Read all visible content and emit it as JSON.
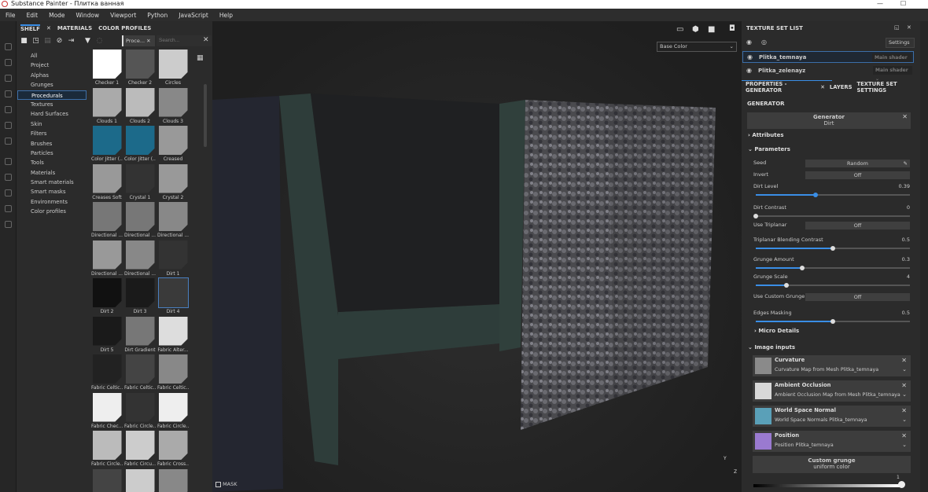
{
  "window": {
    "title": "Substance Painter - Плитка ванная"
  },
  "menu": [
    "File",
    "Edit",
    "Mode",
    "Window",
    "Viewport",
    "Python",
    "JavaScript",
    "Help"
  ],
  "shelf": {
    "tabs": [
      "SHELF",
      "MATERIALS",
      "COLOR PROFILES"
    ],
    "filter_chip": "Proce...",
    "search_placeholder": "Search...",
    "categories": [
      "All",
      "Project",
      "Alphas",
      "Grunges",
      "Procedurals",
      "Textures",
      "Hard Surfaces",
      "Skin",
      "Filters",
      "Brushes",
      "Particles",
      "Tools",
      "Materials",
      "Smart materials",
      "Smart masks",
      "Environments",
      "Color profiles"
    ],
    "selected_category": "Procedurals",
    "items": [
      "Checker 1",
      "Checker 2",
      "Circles",
      "Clouds 1",
      "Clouds 2",
      "Clouds 3",
      "Color Jitter (...",
      "Color Jitter (...",
      "Creased",
      "Creases Soft",
      "Crystal 1",
      "Crystal 2",
      "Directional ...",
      "Directional ...",
      "Directional ...",
      "Directional ...",
      "Directional ...",
      "Dirt 1",
      "Dirt 2",
      "Dirt 3",
      "Dirt 4",
      "Dirt 5",
      "Dirt Gradient",
      "Fabric Alter...",
      "Fabric Celtic...",
      "Fabric Celtic...",
      "Fabric Celtic...",
      "Fabric Chec...",
      "Fabric Circle...",
      "Fabric Circle...",
      "Fabric Circle...",
      "Fabric Circu...",
      "Fabric Cross...",
      "",
      "",
      ""
    ],
    "selected_item": "Dirt 4"
  },
  "viewport": {
    "channel": "Base Color",
    "mask_label": "MASK",
    "axis_y": "Y",
    "axis_z": "Z"
  },
  "texture_set_list": {
    "title": "TEXTURE SET LIST",
    "settings": "Settings",
    "sets": [
      {
        "name": "Plitka_temnaya",
        "shader": "Main shader"
      },
      {
        "name": "Plitka_zelenayz",
        "shader": "Main shader"
      }
    ]
  },
  "properties": {
    "tabs": [
      "PROPERTIES - GENERATOR",
      "LAYERS",
      "TEXTURE SET SETTINGS"
    ],
    "section": "GENERATOR",
    "generator_label": "Generator",
    "generator_value": "Dirt",
    "attributes": "Attributes",
    "parameters": "Parameters",
    "params": [
      {
        "label": "Seed",
        "type": "button",
        "value": "Random"
      },
      {
        "label": "Invert",
        "type": "button",
        "value": "Off"
      },
      {
        "label": "Dirt Level",
        "type": "slider",
        "value": "0.39",
        "fraction": 0.39
      },
      {
        "label": "Dirt Contrast",
        "type": "slider",
        "value": "0",
        "fraction": 0
      },
      {
        "label": "Use Triplanar",
        "type": "button",
        "value": "Off"
      },
      {
        "label": "Triplanar Blending Contrast",
        "type": "slider",
        "value": "0.5",
        "fraction": 0.5
      },
      {
        "label": "Grunge Amount",
        "type": "slider",
        "value": "0.3",
        "fraction": 0.3
      },
      {
        "label": "Grunge Scale",
        "type": "slider",
        "value": "4",
        "fraction": 0.2
      },
      {
        "label": "Use Custom Grunge",
        "type": "button",
        "value": "Off"
      },
      {
        "label": "Edges Masking",
        "type": "slider",
        "value": "0.5",
        "fraction": 0.5
      }
    ],
    "micro_details": "Micro Details",
    "image_inputs": "Image inputs",
    "inputs": [
      {
        "title": "Curvature",
        "source": "Curvature Map from Mesh Plitka_temnaya",
        "color": "#8a8a8a"
      },
      {
        "title": "Ambient Occlusion",
        "source": "Ambient Occlusion Map from Mesh Plitka_temnaya",
        "color": "#d8d8d8"
      },
      {
        "title": "World Space Normal",
        "source": "World Space Normals Plitka_temnaya",
        "color": "#5aa0b8"
      },
      {
        "title": "Position",
        "source": "Position Plitka_temnaya",
        "color": "#9a7ad0"
      }
    ],
    "custom_grunge": "Custom grunge",
    "custom_grunge_value": "uniform color",
    "gradient_value": "1"
  },
  "colors": {
    "accent": "#3a8ee6"
  }
}
